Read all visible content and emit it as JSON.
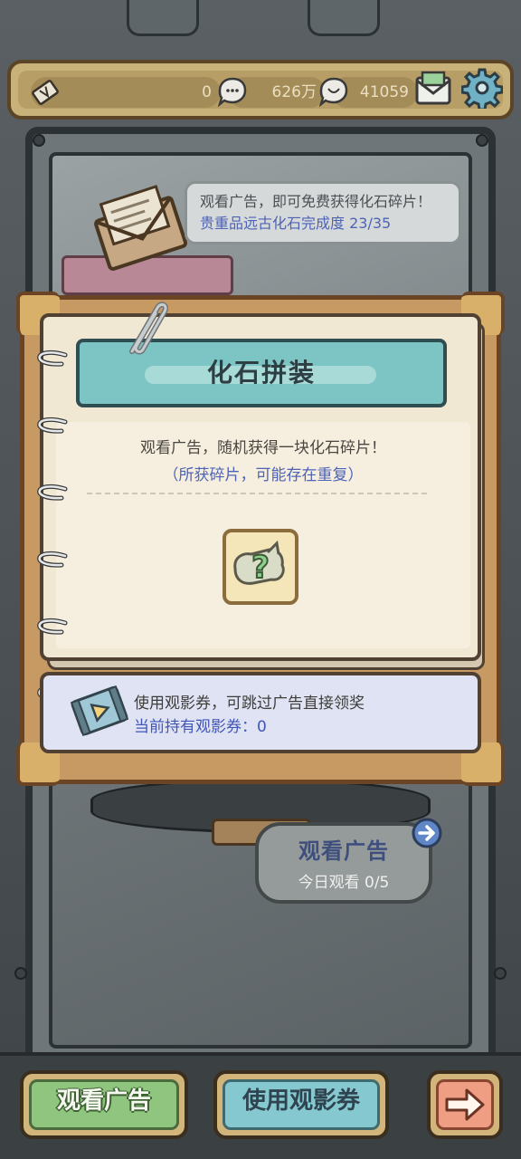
{
  "topbar": {
    "ticket_count": "0",
    "coin_count": "626万",
    "gem_count": "41059",
    "icons": [
      "ticket-icon",
      "coin-bubble-icon",
      "gem-bubble-icon",
      "mail-icon",
      "gear-icon"
    ]
  },
  "hint": {
    "line1": "观看广告，即可免费获得化石碎片！",
    "line2": "贵重品远古化石完成度 23/35"
  },
  "dialog": {
    "title": "化石拼装",
    "description": "观看广告，随机获得一块化石碎片！",
    "note": "（所获碎片，可能存在重复）",
    "fossil_icon": "mystery-fossil-icon"
  },
  "coupon": {
    "line1": "使用观影券，可跳过广告直接领奖",
    "line2": "当前持有观影券：0"
  },
  "ad_panel": {
    "title": "观看广告",
    "daily_count": "今日观看 0/5"
  },
  "buttons": {
    "watch_ad": "观看广告",
    "use_coupon": "使用观影券"
  },
  "colors": {
    "title_banner": "#7dc5c4",
    "highlight_text": "#4d63b5",
    "watch_button": "#8fc57f",
    "coupon_button": "#86c8cf",
    "next_button": "#ef9d83"
  }
}
